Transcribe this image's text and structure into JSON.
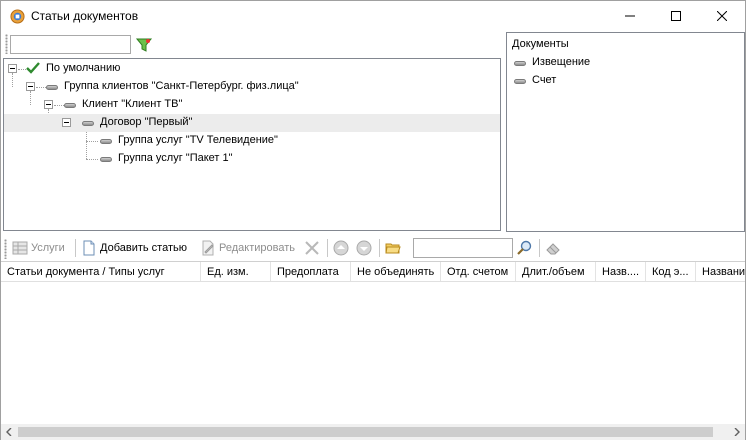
{
  "window": {
    "title": "Статьи документов"
  },
  "left_pane": {
    "search_value": "",
    "tree": [
      {
        "label": "По умолчанию",
        "icon": "check-icon"
      },
      {
        "label": "Группа клиентов \"Санкт-Петербург. физ.лица\"",
        "icon": "node-icon"
      },
      {
        "label": "Клиент \"Клиент ТВ\"",
        "icon": "node-icon"
      },
      {
        "label": "Договор \"Первый\"",
        "icon": "node-icon"
      },
      {
        "label": "Группа услуг \"TV Телевидение\"",
        "icon": "node-icon"
      },
      {
        "label": "Группа услуг \"Пакет 1\"",
        "icon": "node-icon"
      }
    ]
  },
  "right_pane": {
    "header": "Документы",
    "items": [
      {
        "label": "Извещение"
      },
      {
        "label": "Счет"
      }
    ]
  },
  "toolbar": {
    "services_label": "Услуги",
    "add_label": "Добавить статью",
    "edit_label": "Редактировать",
    "search_value": ""
  },
  "grid": {
    "columns": [
      "Статьи документа / Типы услуг",
      "Ед. изм.",
      "Предоплата",
      "Не объединять",
      "Отд. счетом",
      "Длит./объем",
      "Назв....",
      "Код э...",
      "Название"
    ]
  },
  "colors": {
    "check": "#2f8a2f",
    "selected_row": "#ececec",
    "border": "#828790"
  }
}
